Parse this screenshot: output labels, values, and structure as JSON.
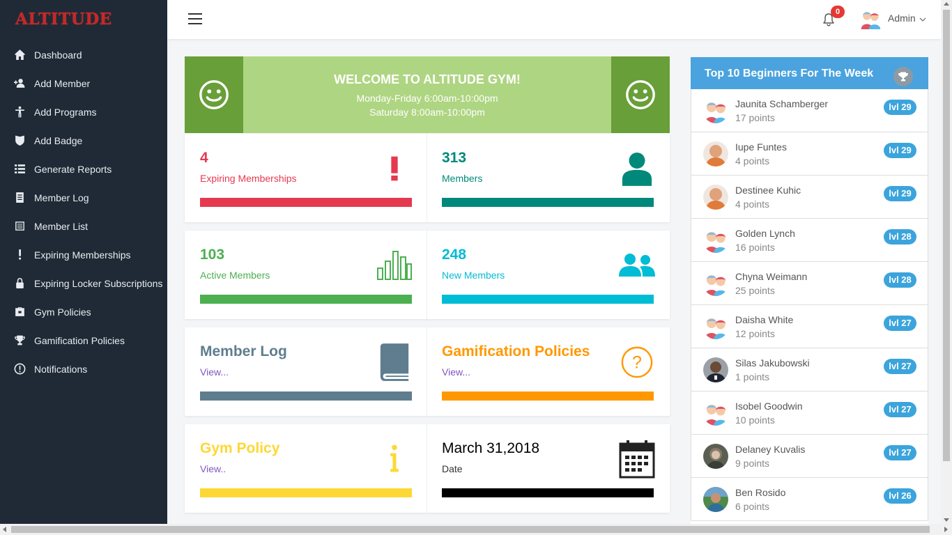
{
  "app": {
    "logo_text": "ALTITUDE",
    "brand_color": "#c62828"
  },
  "sidebar": {
    "items": [
      {
        "label": "Dashboard",
        "icon": "home-icon"
      },
      {
        "label": "Add Member",
        "icon": "add-user-icon"
      },
      {
        "label": "Add Programs",
        "icon": "person-standing-icon"
      },
      {
        "label": "Add Badge",
        "icon": "shield-badge-icon"
      },
      {
        "label": "Generate Reports",
        "icon": "list-icon"
      },
      {
        "label": "Member Log",
        "icon": "document-icon"
      },
      {
        "label": "Member List",
        "icon": "list-alt-icon"
      },
      {
        "label": "Expiring Memberships",
        "icon": "exclamation-icon"
      },
      {
        "label": "Expiring Locker Subscriptions",
        "icon": "lock-icon"
      },
      {
        "label": "Gym Policies",
        "icon": "briefcase-icon"
      },
      {
        "label": "Gamification Policies",
        "icon": "trophy-icon"
      },
      {
        "label": "Notifications",
        "icon": "alert-circle-icon"
      }
    ]
  },
  "topbar": {
    "notification_count": "0",
    "admin_label": "Admin"
  },
  "banner": {
    "title": "WELCOME TO ALTITUDE GYM!",
    "hours_weekday": "Monday-Friday 6:00am-10:00pm",
    "hours_saturday": "Saturday 8:00am-10:00pm"
  },
  "stats": {
    "expiring": {
      "value": "4",
      "label": "Expiring Memberships",
      "color": "#e53950"
    },
    "members": {
      "value": "313",
      "label": "Members",
      "color": "#00897b"
    },
    "active": {
      "value": "103",
      "label": "Active Members",
      "color": "#4caf50"
    },
    "new_members": {
      "value": "248",
      "label": "New Members",
      "color": "#00bcd4"
    },
    "member_log": {
      "title": "Member Log",
      "link": "View...",
      "color": "#5f7d8e"
    },
    "gamification": {
      "title": "Gamification Policies",
      "link": "View...",
      "color": "#ff9800"
    },
    "gym_policy": {
      "title": "Gym Policy",
      "link": "View..",
      "color": "#fdd835"
    },
    "date": {
      "value": "March 31,2018",
      "label": "Date",
      "color": "#000000"
    }
  },
  "leaderboard": {
    "title": "Top 10 Beginners For The Week",
    "entries": [
      {
        "name": "Jaunita Schamberger",
        "points": "17 points",
        "level": "lvl 29",
        "avatar": "cartoon-couple"
      },
      {
        "name": "Iupe Funtes",
        "points": "4 points",
        "level": "lvl 29",
        "avatar": "bald-man"
      },
      {
        "name": "Destinee Kuhic",
        "points": "4 points",
        "level": "lvl 29",
        "avatar": "bald-man"
      },
      {
        "name": "Golden Lynch",
        "points": "16 points",
        "level": "lvl 28",
        "avatar": "cartoon-couple"
      },
      {
        "name": "Chyna Weimann",
        "points": "25 points",
        "level": "lvl 28",
        "avatar": "cartoon-couple"
      },
      {
        "name": "Daisha White",
        "points": "12 points",
        "level": "lvl 27",
        "avatar": "cartoon-couple"
      },
      {
        "name": "Silas Jakubowski",
        "points": "1 points",
        "level": "lvl 27",
        "avatar": "photo-man"
      },
      {
        "name": "Isobel Goodwin",
        "points": "10 points",
        "level": "lvl 27",
        "avatar": "cartoon-couple"
      },
      {
        "name": "Delaney Kuvalis",
        "points": "9 points",
        "level": "lvl 27",
        "avatar": "photo-woman"
      },
      {
        "name": "Ben Rosido",
        "points": "6 points",
        "level": "lvl 26",
        "avatar": "photo-outdoor"
      }
    ]
  }
}
